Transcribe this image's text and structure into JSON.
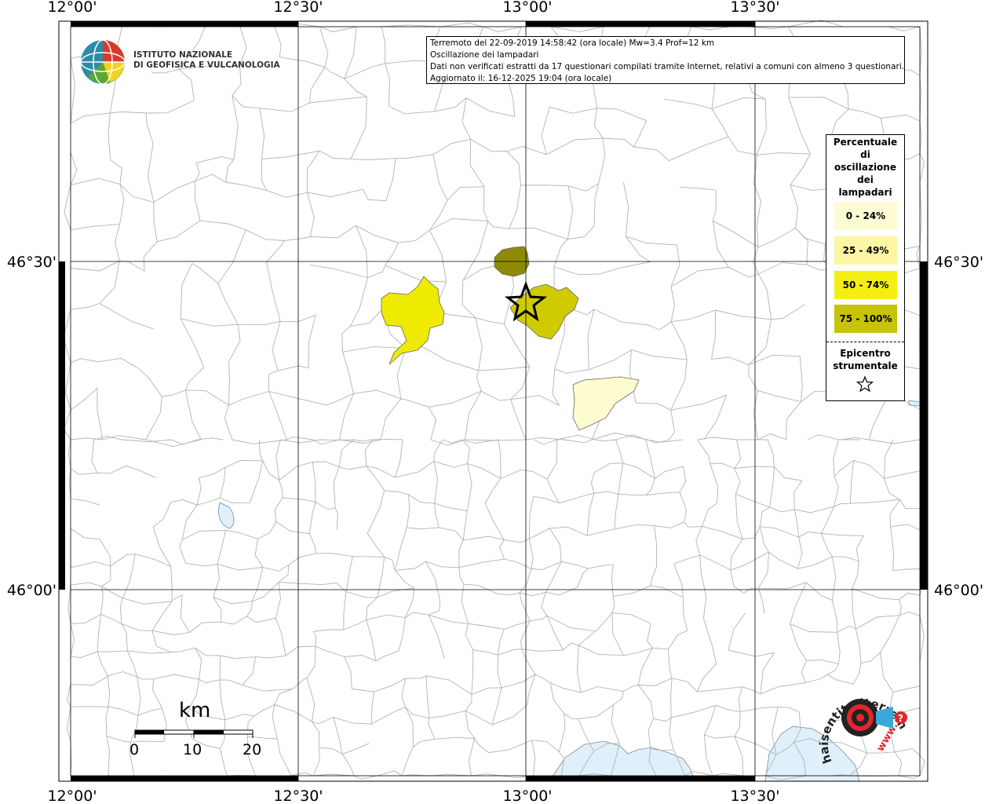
{
  "map": {
    "lon_labels": [
      "12°00'",
      "12°30'",
      "13°00'",
      "13°30'"
    ],
    "lat_labels": [
      "46°30'",
      "46°00'"
    ],
    "colors": {
      "border": "#b0b0b0",
      "water": "#dff0fb",
      "frame": "#000000",
      "grid": "#000000"
    }
  },
  "info": {
    "line1": "Terremoto del 22-09-2019 14:58:42 (ora locale) Mw=3.4 Prof=12 km",
    "line2": "Oscillazione dei lampadari",
    "line3": "Dati non verificati estratti da 17 questionari compilati tramite Internet, relativi a comuni con almeno 3 questionari.",
    "line4": "Aggiornato il: 16-12-2025 19:04 (ora locale)"
  },
  "legend": {
    "title_lines": [
      "Percentuale",
      "di",
      "oscillazione",
      "dei",
      "lampadari"
    ],
    "classes": [
      {
        "label": "0 - 24%",
        "color": "#fdfbd5"
      },
      {
        "label": "25 - 49%",
        "color": "#fbf5a4"
      },
      {
        "label": "50 - 74%",
        "color": "#f4ef13"
      },
      {
        "label": "75 - 100%",
        "color": "#c7c20a"
      }
    ],
    "epicenter_lines": [
      "Epicentro",
      "strumentale"
    ],
    "epicenter_icon": "star-outline-icon"
  },
  "municipalities": [
    {
      "class": 3,
      "color": "#8e8a04"
    },
    {
      "class": 2,
      "color": "#eeea00"
    },
    {
      "class": 3,
      "color": "#cfcb00"
    },
    {
      "class": 0,
      "color": "#fdfbd0"
    }
  ],
  "logos": {
    "ingv_line1": "ISTITUTO NAZIONALE",
    "ingv_line2": "DI GEOFISICA E VULCANOLOGIA",
    "haisentito": "haisentitoilterremoto.it",
    "www": "www."
  },
  "scale": {
    "unit": "km",
    "ticks": [
      "0",
      "10",
      "20"
    ]
  }
}
